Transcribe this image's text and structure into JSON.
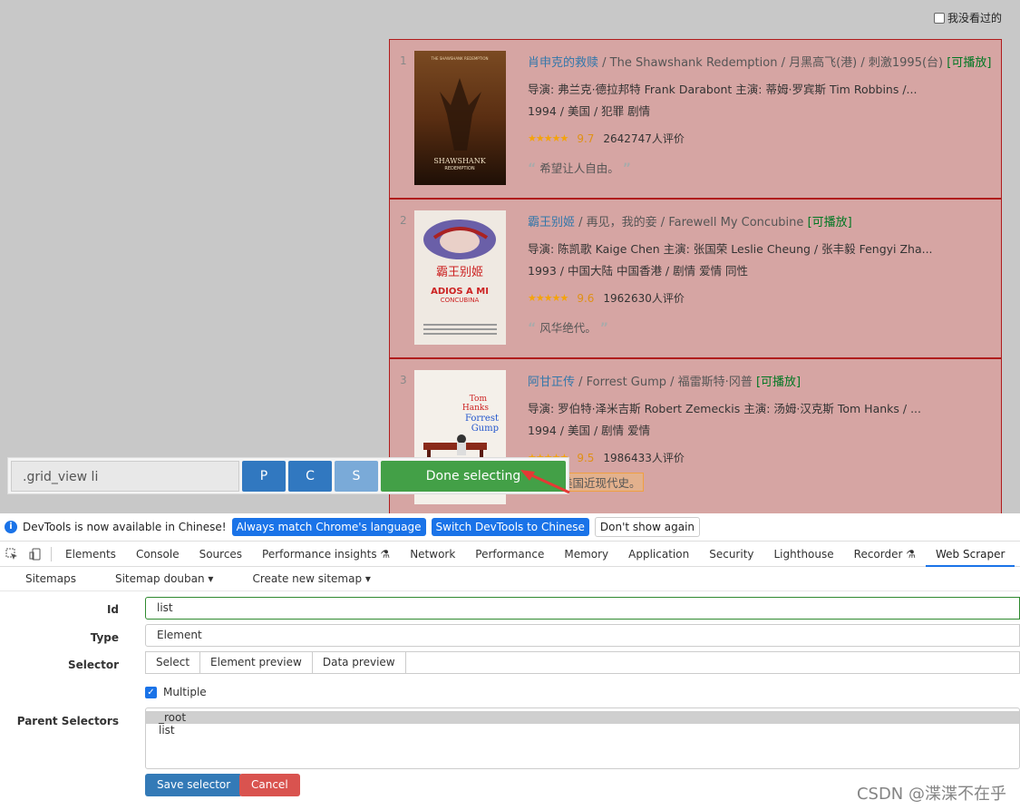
{
  "page": {
    "unseen_label": "我没看过的",
    "movies": [
      {
        "rank": "1",
        "title": "肖申克的救赎",
        "other": "/ The Shawshank Redemption  / 月黑高飞(港) / 刺激1995(台)",
        "playable": "[可播放]",
        "director": "导演: 弗兰克·德拉邦特 Frank Darabont   主演: 蒂姆·罗宾斯 Tim Robbins /...",
        "meta": "1994 / 美国 / 犯罪 剧情",
        "stars": "★★★★★",
        "score": "9.7",
        "votes": "2642747人评价",
        "quote": "希望让人自由。"
      },
      {
        "rank": "2",
        "title": "霸王别姬",
        "other": "/ 再见，我的妾 / Farewell My Concubine",
        "playable": "[可播放]",
        "director": "导演: 陈凯歌 Kaige Chen   主演: 张国荣 Leslie Cheung / 张丰毅 Fengyi Zha...",
        "meta": "1993 / 中国大陆 中国香港 / 剧情 爱情 同性",
        "stars": "★★★★★",
        "score": "9.6",
        "votes": "1962630人评价",
        "quote": "风华绝代。"
      },
      {
        "rank": "3",
        "title": "阿甘正传",
        "other": "/ Forrest Gump  / 福雷斯特·冈普",
        "playable": "[可播放]",
        "director": "导演: 罗伯特·泽米吉斯 Robert Zemeckis   主演: 汤姆·汉克斯 Tom Hanks / ...",
        "meta": "1994 / 美国 / 剧情 爱情",
        "stars": "★★★★★",
        "score": "9.5",
        "votes": "1986433人评价",
        "quote": "美国近现代史。"
      }
    ],
    "posters": {
      "p1_top": "THE SHAWSHANK REDEMPTION",
      "p1_title": "SHAWSHANK",
      "p1_sub": "REDEMPTION",
      "p2_cn": "霸王别姬",
      "p2_title": "ADIOS A MI",
      "p2_sub": "CONCUBINA",
      "p3_name1": "Tom",
      "p3_name2": "Hanks",
      "p3_name3": "Forrest",
      "p3_name4": "Gump"
    }
  },
  "selector_bar": {
    "selector_value": ".grid_view li",
    "p_label": "P",
    "c_label": "C",
    "s_label": "S",
    "done_label": "Done selecting"
  },
  "devtools": {
    "notice_text": "DevTools is now available in Chinese!",
    "btn_match": "Always match Chrome's language",
    "btn_switch": "Switch DevTools to Chinese",
    "btn_dont_show": "Don't show again",
    "tabs": [
      "Elements",
      "Console",
      "Sources",
      "Performance insights ⚗",
      "Network",
      "Performance",
      "Memory",
      "Application",
      "Security",
      "Lighthouse",
      "Recorder ⚗",
      "Web Scraper"
    ],
    "active_tab": "Web Scraper",
    "subnav": [
      "Sitemaps",
      "Sitemap douban ▾",
      "Create new sitemap ▾"
    ],
    "form": {
      "id_label": "Id",
      "id_value": "list",
      "type_label": "Type",
      "type_value": "Element",
      "selector_label": "Selector",
      "selector_buttons": [
        "Select",
        "Element preview",
        "Data preview"
      ],
      "multiple_label": "Multiple",
      "parent_label": "Parent Selectors",
      "parent_options": [
        "_root",
        "list"
      ],
      "save_label": "Save selector",
      "cancel_label": "Cancel"
    }
  },
  "watermark": "CSDN @渫渫不在乎"
}
